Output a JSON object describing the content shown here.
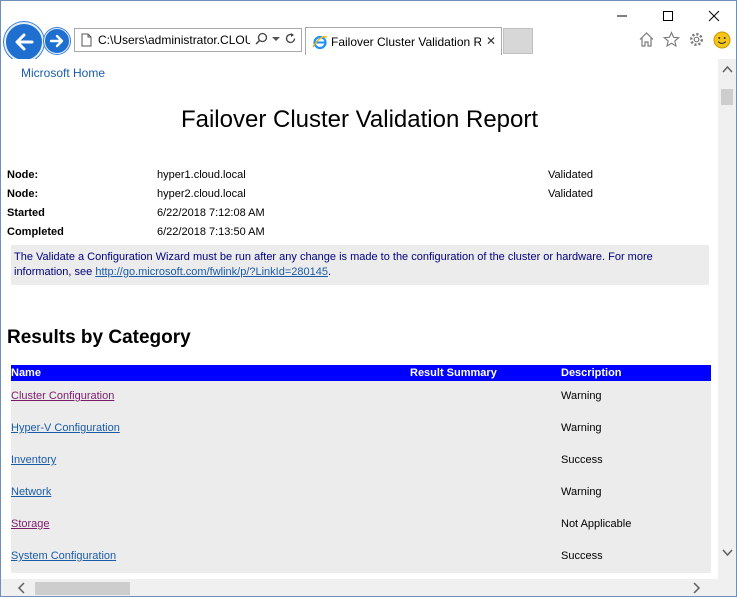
{
  "browser": {
    "address": "C:\\Users\\administrator.CLOUD",
    "tab_title": "Failover Cluster Validation R...",
    "tab_close": "✕"
  },
  "page": {
    "ms_home": "Microsoft Home",
    "title": "Failover Cluster Validation Report",
    "info": [
      {
        "label": "Node:",
        "value": "hyper1.cloud.local",
        "status": "Validated"
      },
      {
        "label": "Node:",
        "value": "hyper2.cloud.local",
        "status": "Validated"
      },
      {
        "label": "Started",
        "value": "6/22/2018 7:12:08 AM",
        "status": ""
      },
      {
        "label": "Completed",
        "value": "6/22/2018 7:13:50 AM",
        "status": ""
      }
    ],
    "notice_text": "The Validate a Configuration Wizard must be run after any change is made to the configuration of the cluster or hardware. For more information, see ",
    "notice_link": "http://go.microsoft.com/fwlink/p/?LinkId=280145",
    "notice_end": ".",
    "results_heading": "Results by Category",
    "table": {
      "headers": [
        "Name",
        "Result Summary",
        "Description"
      ],
      "rows": [
        {
          "name": "Cluster Configuration",
          "description": "Warning",
          "visited": true
        },
        {
          "name": "Hyper-V Configuration",
          "description": "Warning",
          "visited": false
        },
        {
          "name": "Inventory",
          "description": "Success",
          "visited": false
        },
        {
          "name": "Network",
          "description": "Warning",
          "visited": false
        },
        {
          "name": "Storage",
          "description": "Not Applicable",
          "visited": true
        },
        {
          "name": "System Configuration",
          "description": "Success",
          "visited": false
        }
      ]
    }
  },
  "colors": {
    "header_blue": "#0000ff",
    "row_grey": "#ececec",
    "link": "#1a5ca8",
    "visited_link": "#7b1a6b"
  }
}
